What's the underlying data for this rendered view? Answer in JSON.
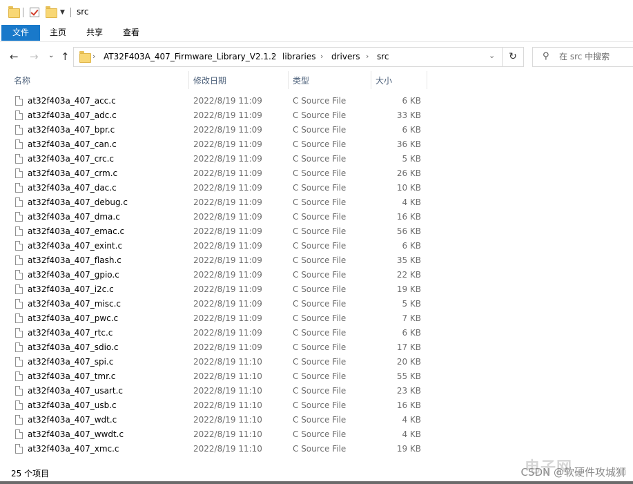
{
  "window": {
    "title": "src"
  },
  "ribbon": {
    "tabs": [
      "文件",
      "主页",
      "共享",
      "查看"
    ]
  },
  "address": {
    "crumbs": [
      "AT32F403A_407_Firmware_Library_V2.1.2",
      "libraries",
      "drivers",
      "src"
    ]
  },
  "search": {
    "placeholder": "在 src 中搜索"
  },
  "columns": {
    "name": "名称",
    "date": "修改日期",
    "type": "类型",
    "size": "大小"
  },
  "files": [
    {
      "name": "at32f403a_407_acc.c",
      "date": "2022/8/19 11:09",
      "type": "C Source File",
      "size": "6 KB"
    },
    {
      "name": "at32f403a_407_adc.c",
      "date": "2022/8/19 11:09",
      "type": "C Source File",
      "size": "33 KB"
    },
    {
      "name": "at32f403a_407_bpr.c",
      "date": "2022/8/19 11:09",
      "type": "C Source File",
      "size": "6 KB"
    },
    {
      "name": "at32f403a_407_can.c",
      "date": "2022/8/19 11:09",
      "type": "C Source File",
      "size": "36 KB"
    },
    {
      "name": "at32f403a_407_crc.c",
      "date": "2022/8/19 11:09",
      "type": "C Source File",
      "size": "5 KB"
    },
    {
      "name": "at32f403a_407_crm.c",
      "date": "2022/8/19 11:09",
      "type": "C Source File",
      "size": "26 KB"
    },
    {
      "name": "at32f403a_407_dac.c",
      "date": "2022/8/19 11:09",
      "type": "C Source File",
      "size": "10 KB"
    },
    {
      "name": "at32f403a_407_debug.c",
      "date": "2022/8/19 11:09",
      "type": "C Source File",
      "size": "4 KB"
    },
    {
      "name": "at32f403a_407_dma.c",
      "date": "2022/8/19 11:09",
      "type": "C Source File",
      "size": "16 KB"
    },
    {
      "name": "at32f403a_407_emac.c",
      "date": "2022/8/19 11:09",
      "type": "C Source File",
      "size": "56 KB"
    },
    {
      "name": "at32f403a_407_exint.c",
      "date": "2022/8/19 11:09",
      "type": "C Source File",
      "size": "6 KB"
    },
    {
      "name": "at32f403a_407_flash.c",
      "date": "2022/8/19 11:09",
      "type": "C Source File",
      "size": "35 KB"
    },
    {
      "name": "at32f403a_407_gpio.c",
      "date": "2022/8/19 11:09",
      "type": "C Source File",
      "size": "22 KB"
    },
    {
      "name": "at32f403a_407_i2c.c",
      "date": "2022/8/19 11:09",
      "type": "C Source File",
      "size": "19 KB"
    },
    {
      "name": "at32f403a_407_misc.c",
      "date": "2022/8/19 11:09",
      "type": "C Source File",
      "size": "5 KB"
    },
    {
      "name": "at32f403a_407_pwc.c",
      "date": "2022/8/19 11:09",
      "type": "C Source File",
      "size": "7 KB"
    },
    {
      "name": "at32f403a_407_rtc.c",
      "date": "2022/8/19 11:09",
      "type": "C Source File",
      "size": "6 KB"
    },
    {
      "name": "at32f403a_407_sdio.c",
      "date": "2022/8/19 11:09",
      "type": "C Source File",
      "size": "17 KB"
    },
    {
      "name": "at32f403a_407_spi.c",
      "date": "2022/8/19 11:10",
      "type": "C Source File",
      "size": "20 KB"
    },
    {
      "name": "at32f403a_407_tmr.c",
      "date": "2022/8/19 11:10",
      "type": "C Source File",
      "size": "55 KB"
    },
    {
      "name": "at32f403a_407_usart.c",
      "date": "2022/8/19 11:10",
      "type": "C Source File",
      "size": "23 KB"
    },
    {
      "name": "at32f403a_407_usb.c",
      "date": "2022/8/19 11:10",
      "type": "C Source File",
      "size": "16 KB"
    },
    {
      "name": "at32f403a_407_wdt.c",
      "date": "2022/8/19 11:10",
      "type": "C Source File",
      "size": "4 KB"
    },
    {
      "name": "at32f403a_407_wwdt.c",
      "date": "2022/8/19 11:10",
      "type": "C Source File",
      "size": "4 KB"
    },
    {
      "name": "at32f403a_407_xmc.c",
      "date": "2022/8/19 11:10",
      "type": "C Source File",
      "size": "19 KB"
    }
  ],
  "status": {
    "item_count": "25 个项目"
  },
  "watermark": {
    "text": "CSDN @软硬件攻城狮",
    "logo": "电子网"
  },
  "colors": {
    "accent": "#1979ca",
    "header_text": "#4c607a",
    "meta_text": "#6d6d6d"
  }
}
